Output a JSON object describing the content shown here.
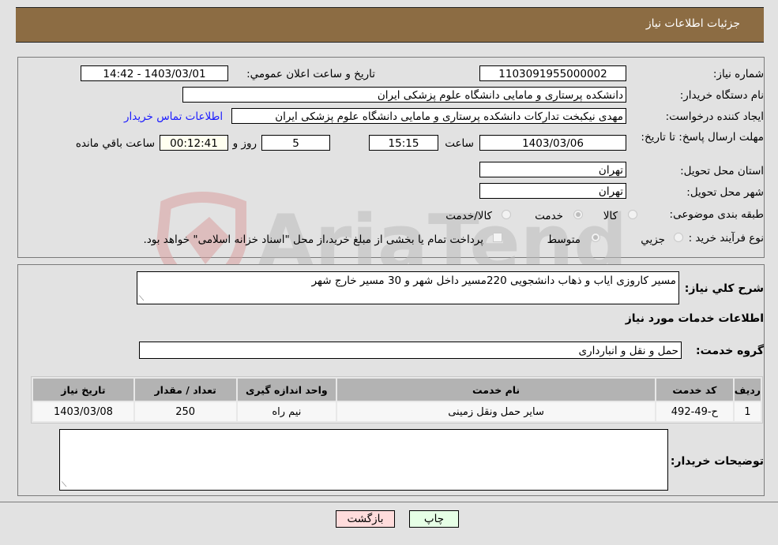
{
  "header": {
    "title": "جزئیات اطلاعات نیاز"
  },
  "details": {
    "need_number": {
      "label": "شماره نیاز:",
      "value": "1103091955000002"
    },
    "announce_datetime": {
      "label": "تاريخ و ساعت اعلان عمومي:",
      "value": "1403/03/01 - 14:42"
    },
    "buyer_org": {
      "label": "نام دستگاه خریدار:",
      "value": "دانشکده پرستاری و مامایی دانشگاه علوم پزشکی ایران"
    },
    "requester": {
      "label": "ایجاد کننده درخواست:",
      "value": "مهدی نیکبخت تدارکات  دانشکده پرستاری و مامایی دانشگاه علوم پزشکی ایران"
    },
    "buyer_contact_link": "اطلاعات تماس خریدار",
    "deadline": {
      "label": "مهلت ارسال پاسخ: تا تاریخ:",
      "date": "1403/03/06",
      "time_label": "ساعت",
      "time": "15:15",
      "days": "5",
      "days_label": "روز و",
      "remaining": "00:12:41",
      "remaining_label": "ساعت باقي مانده"
    },
    "province": {
      "label": "استان محل تحویل:",
      "value": "تهران"
    },
    "city": {
      "label": "شهر محل تحویل:",
      "value": "تهران"
    },
    "category": {
      "label": "طبقه بندی موضوعی:",
      "options": [
        "کالا",
        "خدمت",
        "کالا/خدمت"
      ],
      "selected": "خدمت"
    },
    "purchase_process": {
      "label": "نوع فرآیند خرید :",
      "options": [
        "جزيي",
        "متوسط"
      ],
      "selected": "متوسط",
      "treasury_note": "پرداخت تمام یا بخشی از مبلغ خرید،از محل \"اسناد خزانه اسلامی\" خواهد بود."
    }
  },
  "description": {
    "label": "شرح کلي نياز:",
    "value": "مسیر کاروزی ایاب و ذهاب دانشجویی 220مسیر داخل شهر و 30 مسیر خارج شهر"
  },
  "services": {
    "section_title": "اطلاعات خدمات مورد نیاز",
    "group_label": "گروه خدمت:",
    "group_value": "حمل و نقل و انبارداری",
    "table": {
      "headers": [
        "ردیف",
        "کد خدمت",
        "نام خدمت",
        "واحد اندازه گیری",
        "تعداد / مقدار",
        "تاریخ نیاز"
      ],
      "rows": [
        [
          "1",
          "ح-49-492",
          "سایر حمل ونقل زمینی",
          "نیم راه",
          "250",
          "1403/03/08"
        ]
      ]
    }
  },
  "buyer_notes": {
    "label": "توضیحات خریدار:",
    "value": ""
  },
  "buttons": {
    "print": "چاپ",
    "back": "بازگشت"
  },
  "watermark": {
    "text": "AriaTender.neT"
  },
  "colors": {
    "header_bg": "#8c6c43",
    "link": "#1a1aff",
    "back_btn": "#ffdcdc",
    "print_btn": "#e6ffe6",
    "countdown_bg": "#fffff0"
  }
}
